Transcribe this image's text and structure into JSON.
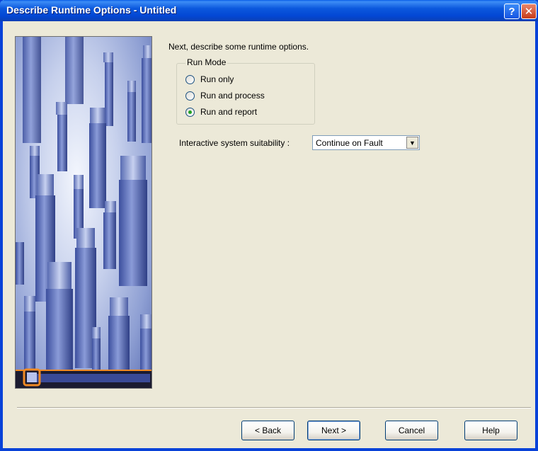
{
  "window": {
    "title": "Describe Runtime Options - Untitled"
  },
  "titlebar_buttons": {
    "help": "?",
    "close": "✕"
  },
  "instruction": "Next, describe some runtime options.",
  "run_mode": {
    "legend": "Run Mode",
    "options": [
      {
        "label": "Run only",
        "checked": false
      },
      {
        "label": "Run and process",
        "checked": false
      },
      {
        "label": "Run and report",
        "checked": true
      }
    ]
  },
  "suitability": {
    "label": "Interactive system suitability :",
    "value": "Continue on Fault"
  },
  "buttons": {
    "back": "< Back",
    "next": "Next >",
    "cancel": "Cancel",
    "help": "Help"
  },
  "colors": {
    "titlebar": "#0A5FE8",
    "dialog_bg": "#ECE9D8",
    "radio_dot": "#21A121",
    "banner_bar": "#F08A24"
  }
}
